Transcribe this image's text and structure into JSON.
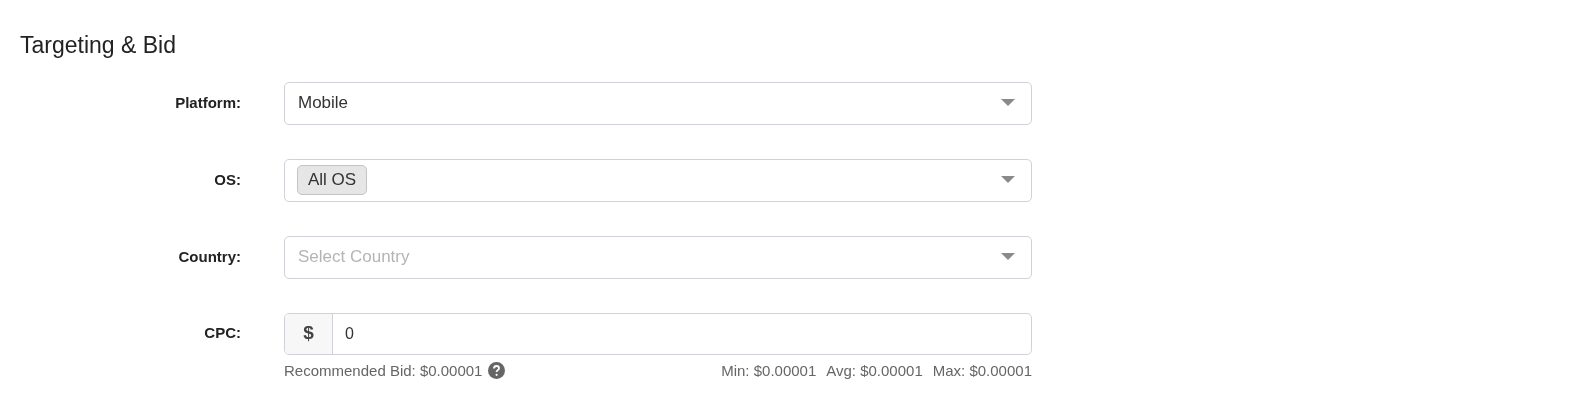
{
  "heading": "Targeting & Bid",
  "fields": [
    {
      "kind": "select",
      "label": "Platform:",
      "value": "Mobile"
    },
    {
      "kind": "tags",
      "label": "OS:",
      "tags": [
        "All OS"
      ]
    },
    {
      "kind": "select",
      "label": "Country:",
      "placeholder": "Select Country"
    },
    {
      "kind": "money",
      "label": "CPC:",
      "prefix": "$",
      "value": "0"
    }
  ],
  "bid": {
    "recommended": "Recommended Bid: $0.00001",
    "stats": [
      "Min: $0.00001",
      "Avg: $0.00001",
      "Max: $0.00001"
    ]
  }
}
